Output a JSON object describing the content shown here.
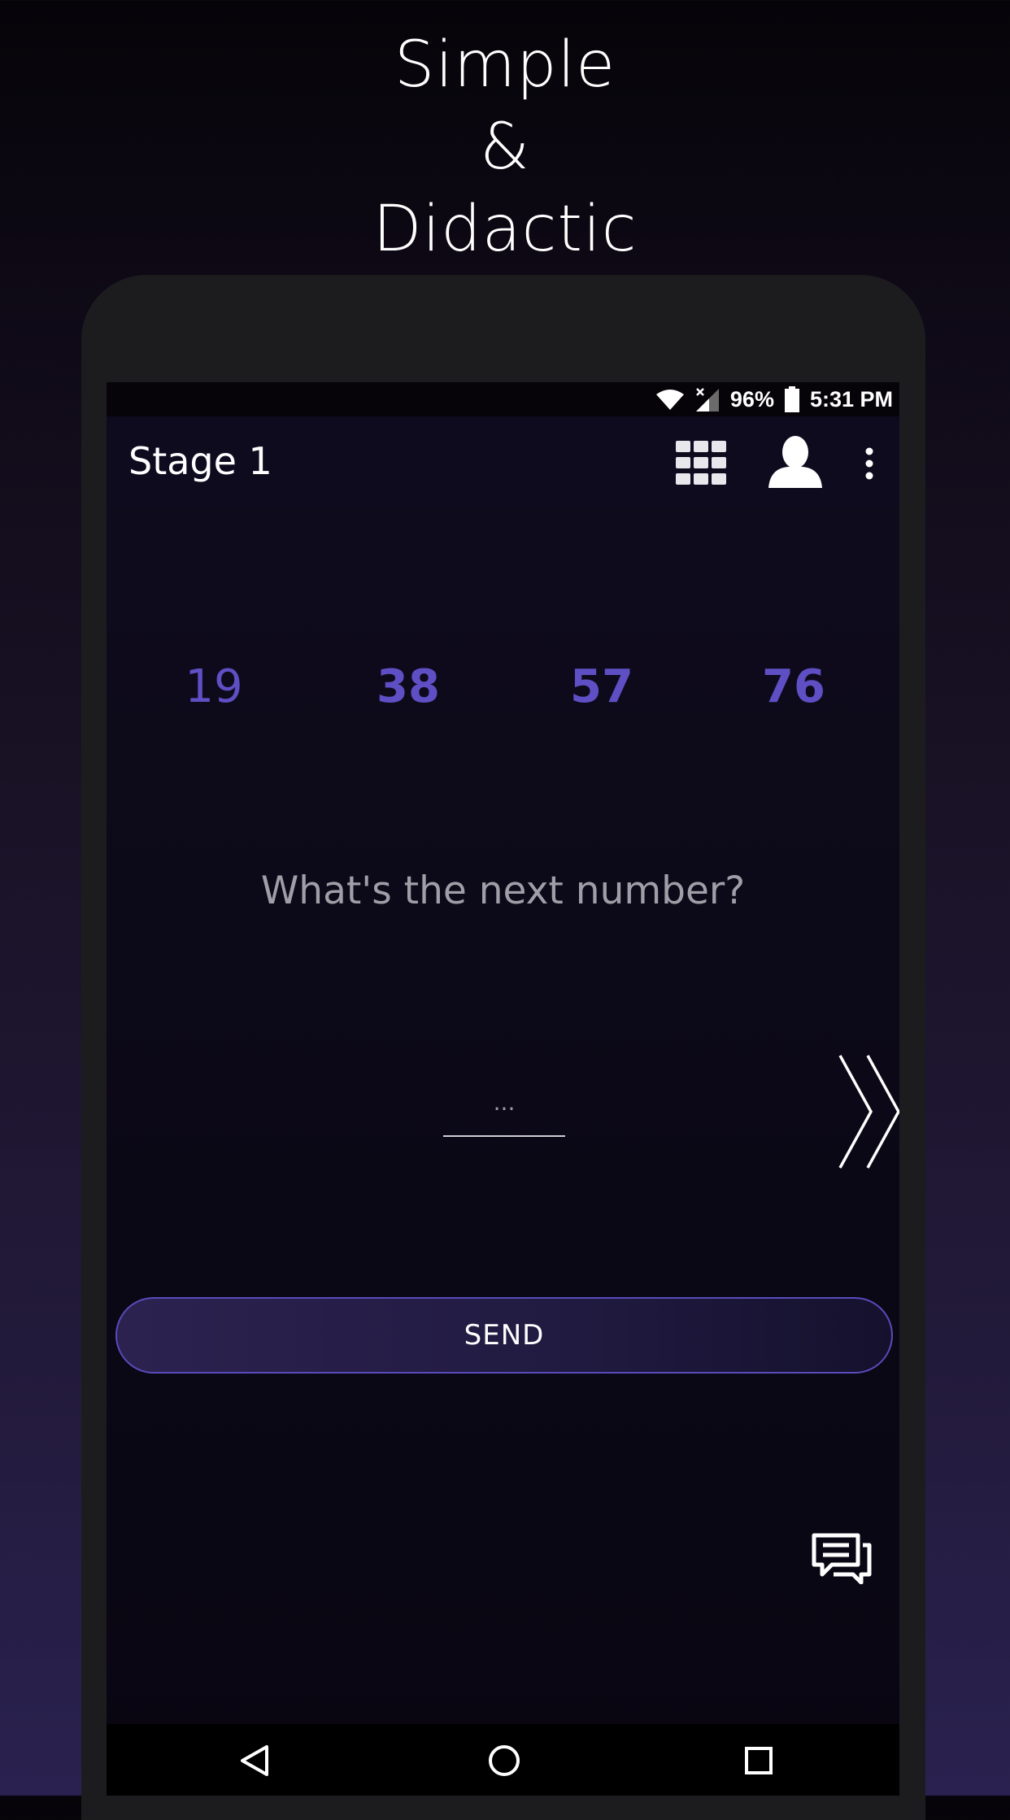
{
  "promo": {
    "line1": "Simple",
    "line2": "&",
    "line3": "Didactic"
  },
  "status_bar": {
    "battery": "96%",
    "time": "5:31 PM",
    "icons": [
      "wifi-icon",
      "no-signal-icon",
      "battery-icon"
    ]
  },
  "app_bar": {
    "title": "Stage 1",
    "actions": [
      "grid-icon",
      "profile-icon",
      "overflow-menu-icon"
    ]
  },
  "sequence": [
    "19",
    "38",
    "57",
    "76"
  ],
  "question": "What's the next number?",
  "answer_input": {
    "placeholder": "...",
    "value": ""
  },
  "send_button": "SEND",
  "nav_bar": [
    "back-icon",
    "home-icon",
    "recents-icon"
  ],
  "colors": {
    "accent": "#5f4fc4",
    "button_border": "#5a4bbd",
    "background_top": "#060409",
    "background_bottom": "#2a2150"
  }
}
